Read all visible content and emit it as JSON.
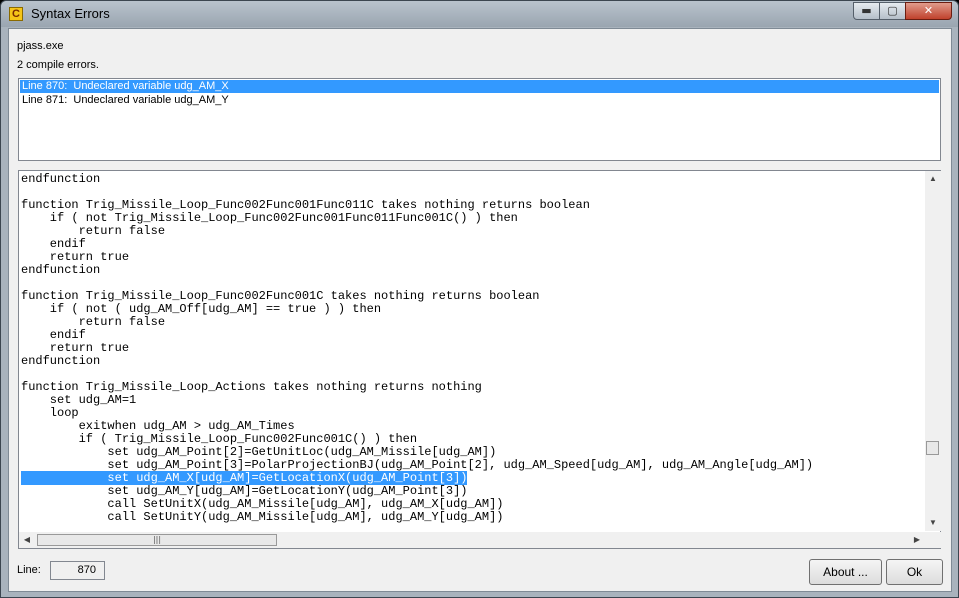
{
  "window": {
    "title": "Syntax Errors",
    "icon_letter": "C"
  },
  "title_buttons": {
    "minimize": "▬",
    "maximize": "▢",
    "close": "✕"
  },
  "header": {
    "program": "pjass.exe",
    "summary": "2 compile errors."
  },
  "errors": [
    "Line 870:  Undeclared variable udg_AM_X",
    "Line 871:  Undeclared variable udg_AM_Y"
  ],
  "selected_error_index": 0,
  "code": {
    "lines": [
      "endfunction",
      "",
      "function Trig_Missile_Loop_Func002Func001Func011C takes nothing returns boolean",
      "    if ( not Trig_Missile_Loop_Func002Func001Func011Func001C() ) then",
      "        return false",
      "    endif",
      "    return true",
      "endfunction",
      "",
      "function Trig_Missile_Loop_Func002Func001C takes nothing returns boolean",
      "    if ( not ( udg_AM_Off[udg_AM] == true ) ) then",
      "        return false",
      "    endif",
      "    return true",
      "endfunction",
      "",
      "function Trig_Missile_Loop_Actions takes nothing returns nothing",
      "    set udg_AM=1",
      "    loop",
      "        exitwhen udg_AM > udg_AM_Times",
      "        if ( Trig_Missile_Loop_Func002Func001C() ) then",
      "            set udg_AM_Point[2]=GetUnitLoc(udg_AM_Missile[udg_AM])",
      "            set udg_AM_Point[3]=PolarProjectionBJ(udg_AM_Point[2], udg_AM_Speed[udg_AM], udg_AM_Angle[udg_AM])",
      "            set udg_AM_X[udg_AM]=GetLocationX(udg_AM_Point[3])",
      "            set udg_AM_Y[udg_AM]=GetLocationY(udg_AM_Point[3])",
      "            call SetUnitX(udg_AM_Missile[udg_AM], udg_AM_X[udg_AM])",
      "            call SetUnitY(udg_AM_Missile[udg_AM], udg_AM_Y[udg_AM])"
    ],
    "highlighted_line_index": 23
  },
  "footer": {
    "line_label": "Line:",
    "line_value": "870",
    "about_label": "About ...",
    "ok_label": "Ok"
  },
  "colors": {
    "selection": "#3399ff",
    "title_gradient": "#9aa5b0"
  }
}
